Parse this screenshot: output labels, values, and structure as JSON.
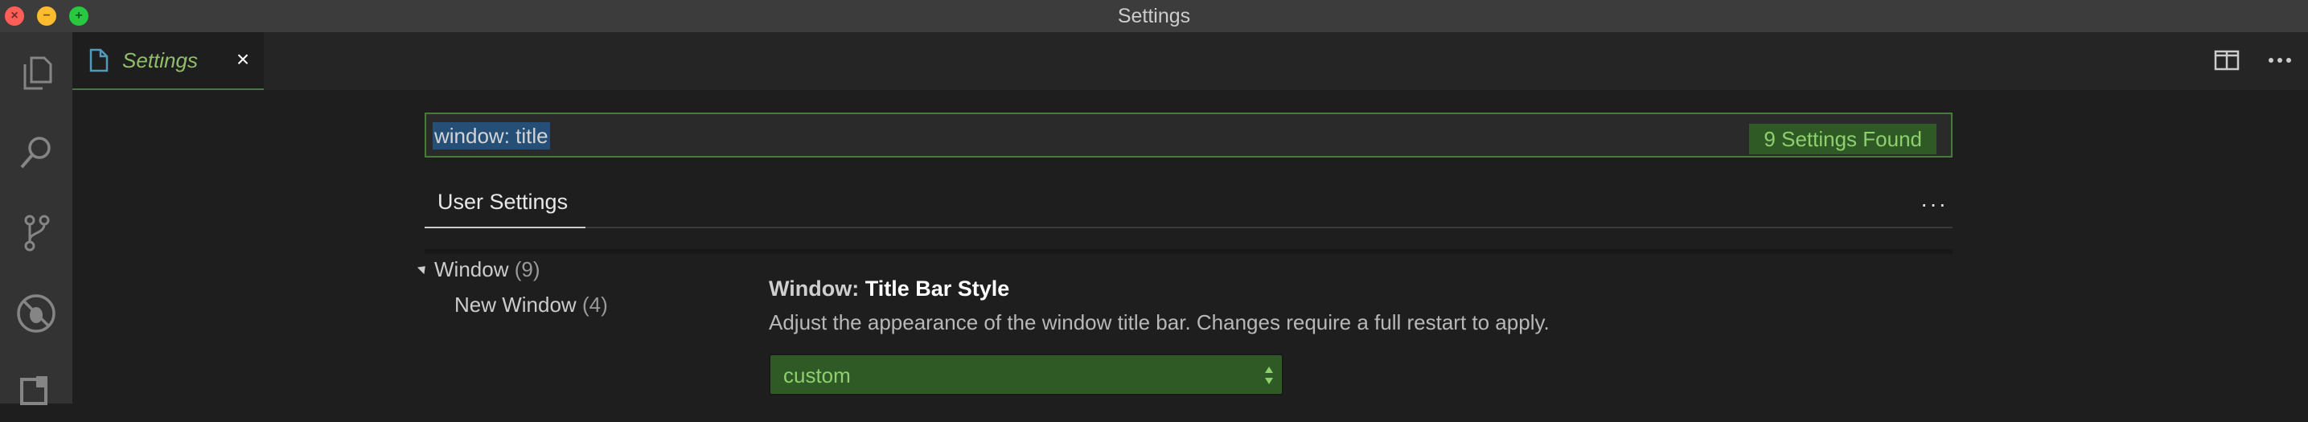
{
  "window": {
    "title": "Settings"
  },
  "activity_bar": {
    "icons": [
      "explorer-icon",
      "search-icon",
      "source-control-icon",
      "debug-icon",
      "extensions-icon"
    ]
  },
  "tabs": [
    {
      "label": "Settings",
      "icon": "file-icon",
      "close": "×"
    }
  ],
  "editor_actions": [
    "split-editor-icon",
    "more-actions-icon"
  ],
  "search": {
    "query": "window: title",
    "result_badge": "9 Settings Found"
  },
  "settings_tabs": {
    "active": "User Settings",
    "more": "···"
  },
  "toc": [
    {
      "label": "Window",
      "count": "(9)",
      "expanded": true
    },
    {
      "label": "New Window",
      "count": "(4)"
    }
  ],
  "setting": {
    "category": "Window: ",
    "key": "Title Bar Style",
    "description": "Adjust the appearance of the window title bar. Changes require a full restart to apply.",
    "value": "custom"
  },
  "colors": {
    "accent_green": "#8ecf6e",
    "badge_bg": "#2f5a25",
    "selection": "#264f78"
  }
}
